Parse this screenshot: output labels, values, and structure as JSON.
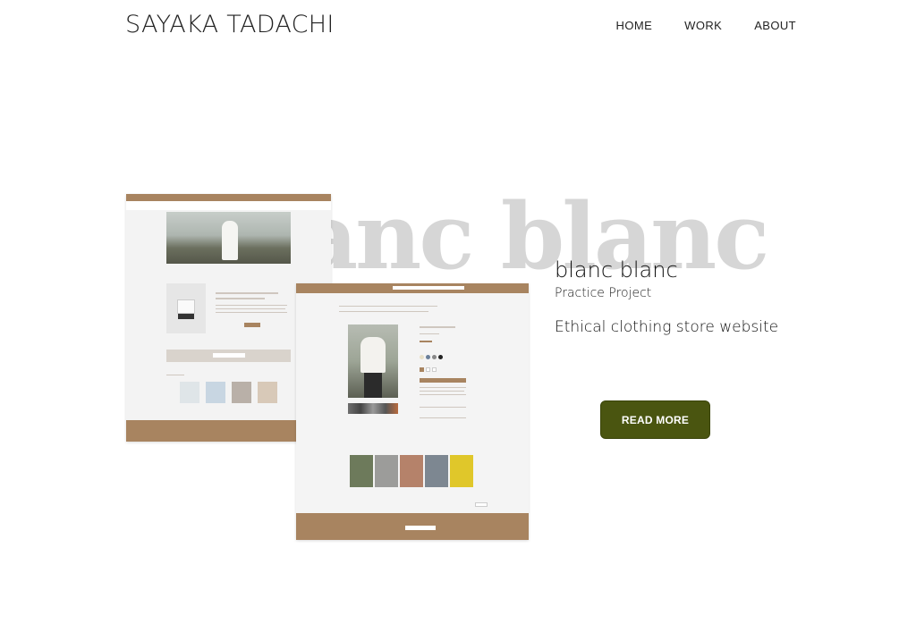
{
  "header": {
    "brand": "SAYAKA TADACHI",
    "nav": [
      {
        "label": "HOME"
      },
      {
        "label": "WORK"
      },
      {
        "label": "ABOUT"
      }
    ]
  },
  "project": {
    "watermark": "blanc blanc",
    "title": "blanc blanc",
    "subtitle": "Practice Project",
    "description": "Ethical clothing store website",
    "cta_label": "READ MORE"
  },
  "colors": {
    "accent": "#4a5510",
    "mock_bar": "#a88460",
    "watermark": "#d6d6d6"
  }
}
